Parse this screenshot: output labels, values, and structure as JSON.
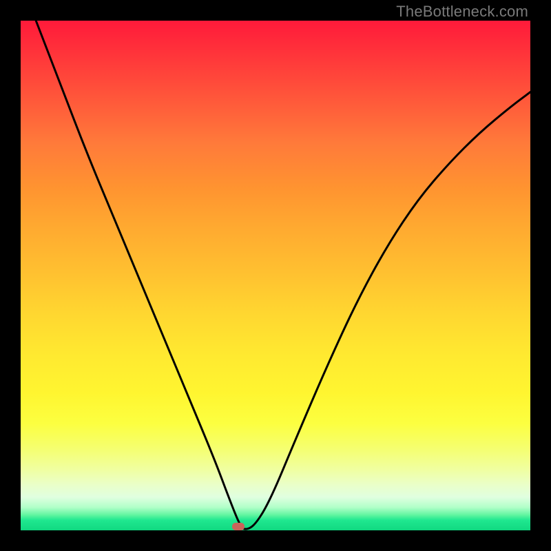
{
  "watermark": "TheBottleneck.com",
  "chart_data": {
    "type": "line",
    "title": "",
    "xlabel": "",
    "ylabel": "",
    "xlim": [
      0,
      100
    ],
    "ylim": [
      0,
      100
    ],
    "background_gradient": {
      "direction": "vertical",
      "stops": [
        {
          "pos": 0,
          "color": "#ff1a3a",
          "meaning": "high-bottleneck"
        },
        {
          "pos": 50,
          "color": "#ffd030",
          "meaning": "moderate"
        },
        {
          "pos": 100,
          "color": "#10d880",
          "meaning": "optimal"
        }
      ]
    },
    "series": [
      {
        "name": "bottleneck-curve",
        "type": "line",
        "color": "#000000",
        "points_xy": [
          [
            3,
            100
          ],
          [
            8,
            87
          ],
          [
            13,
            74
          ],
          [
            18,
            62
          ],
          [
            23,
            50
          ],
          [
            28,
            38
          ],
          [
            33,
            26
          ],
          [
            38,
            14
          ],
          [
            41,
            6
          ],
          [
            43,
            1
          ],
          [
            44,
            0
          ],
          [
            46,
            1
          ],
          [
            49,
            6
          ],
          [
            54,
            18
          ],
          [
            60,
            32
          ],
          [
            66,
            45
          ],
          [
            72,
            56
          ],
          [
            78,
            65
          ],
          [
            84,
            72
          ],
          [
            90,
            78
          ],
          [
            96,
            83
          ],
          [
            100,
            86
          ]
        ]
      }
    ],
    "markers": [
      {
        "name": "optimal-point",
        "x": 44,
        "y": 0,
        "shape": "rounded-rect",
        "color": "#c9655a"
      }
    ]
  }
}
